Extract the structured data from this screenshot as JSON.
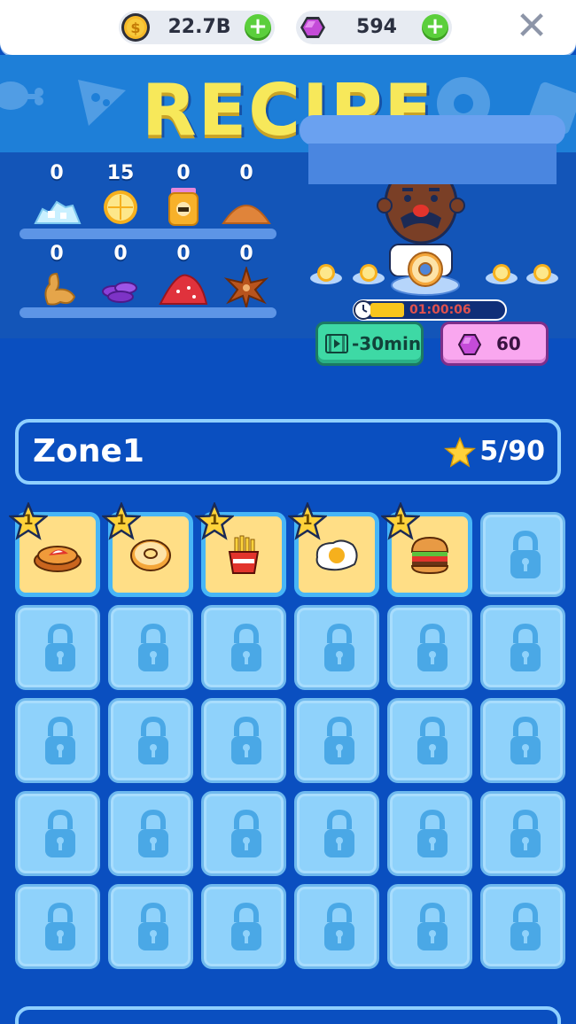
{
  "topbar": {
    "coins": "22.7B",
    "coins_icon": "coin-icon",
    "gems": "594",
    "gems_icon": "gem-icon",
    "plus": "+",
    "close": "✕"
  },
  "banner": {
    "title": "RECIPE"
  },
  "ingredients": [
    {
      "name": "salt",
      "count": "0",
      "icon": "salt-icon"
    },
    {
      "name": "lemon",
      "count": "15",
      "icon": "lemon-icon"
    },
    {
      "name": "honey",
      "count": "0",
      "icon": "honey-jar-icon"
    },
    {
      "name": "flour",
      "count": "0",
      "icon": "flour-pile-icon"
    },
    {
      "name": "ginger",
      "count": "0",
      "icon": "ginger-icon"
    },
    {
      "name": "beans",
      "count": "0",
      "icon": "purple-beans-icon"
    },
    {
      "name": "chili",
      "count": "0",
      "icon": "chili-pile-icon"
    },
    {
      "name": "star-anise",
      "count": "0",
      "icon": "star-anise-icon"
    }
  ],
  "cooking": {
    "timer": "01:00:06",
    "progress": 0.25,
    "skip_label": "-30min",
    "gem_cost": "60"
  },
  "zone": {
    "name": "Zone1",
    "stars": "5/90"
  },
  "recipes": [
    {
      "icon": "pie-icon",
      "stars": "1",
      "unlocked": true
    },
    {
      "icon": "donut-icon",
      "stars": "1",
      "unlocked": true
    },
    {
      "icon": "fries-icon",
      "stars": "1",
      "unlocked": true
    },
    {
      "icon": "fried-egg-icon",
      "stars": "1",
      "unlocked": true
    },
    {
      "icon": "burger-icon",
      "stars": "1",
      "unlocked": true
    }
  ],
  "locked_count": 25,
  "colors": {
    "background": "#0a4fc0",
    "unlocked_tile": "#ffde86",
    "locked_tile": "#8fd2fb",
    "title": "#f7e85a",
    "skip_button": "#3ed9a5",
    "gem_button": "#f9a7ef"
  }
}
